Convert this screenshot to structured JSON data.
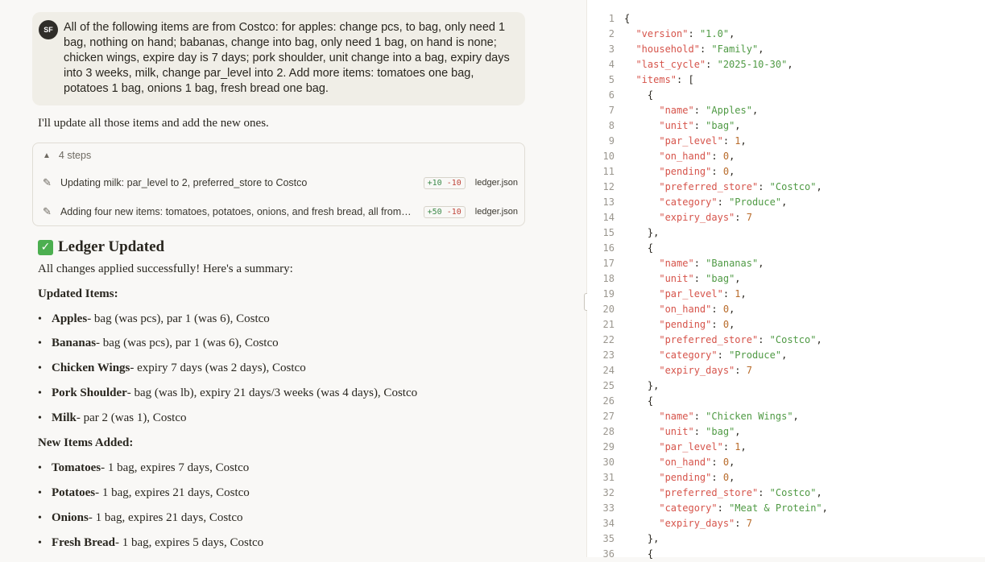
{
  "user_message": {
    "avatar": "SF",
    "lines": [
      "All of the following items are from Costco: for apples: change pcs, to bag, only need 1",
      "bag, nothing on hand; babanas, change into bag, only need 1 bag, on hand is none;",
      "chicken wings, expire day is 7 days; pork shoulder, unit change into a bag, expiry days",
      "into 3 weeks, milk, change par_level into 2. Add more items: tomatoes one bag,",
      "potatoes 1 bag, onions 1 bag, fresh bread one bag."
    ]
  },
  "reply_intro": "I'll update all those items and add the new ones.",
  "steps": {
    "label": "4 steps",
    "items": [
      {
        "text": "Updating milk: par_level to 2, preferred_store to Costco",
        "added": "+10",
        "removed": "-10",
        "file": "ledger.json"
      },
      {
        "text": "Adding four new items: tomatoes, potatoes, onions, and fresh bread, all from…",
        "added": "+50",
        "removed": "-10",
        "file": "ledger.json"
      }
    ]
  },
  "result": {
    "heading": "Ledger Updated",
    "summary": "All changes applied successfully! Here's a summary:",
    "updated_title": "Updated Items:",
    "updated": [
      {
        "name": "Apples",
        "detail": " - bag (was pcs), par 1 (was 6), Costco"
      },
      {
        "name": "Bananas",
        "detail": " - bag (was pcs), par 1 (was 6), Costco"
      },
      {
        "name": "Chicken Wings",
        "detail": " - expiry 7 days (was 2 days), Costco"
      },
      {
        "name": "Pork Shoulder",
        "detail": " - bag (was lb), expiry 21 days/3 weeks (was 4 days), Costco"
      },
      {
        "name": "Milk",
        "detail": " - par 2 (was 1), Costco"
      }
    ],
    "new_title": "New Items Added:",
    "new_items": [
      {
        "name": "Tomatoes",
        "detail": " - 1 bag, expires 7 days, Costco"
      },
      {
        "name": "Potatoes",
        "detail": " - 1 bag, expires 21 days, Costco"
      },
      {
        "name": "Onions",
        "detail": " - 1 bag, expires 21 days, Costco"
      },
      {
        "name": "Fresh Bread",
        "detail": " - 1 bag, expires 5 days, Costco"
      }
    ]
  },
  "code_lines": [
    {
      "n": "1",
      "t": [
        [
          "p",
          "{"
        ]
      ]
    },
    {
      "n": "2",
      "t": [
        [
          "p",
          "  "
        ],
        [
          "k",
          "\"version\""
        ],
        [
          "p",
          ": "
        ],
        [
          "s",
          "\"1.0\""
        ],
        [
          "p",
          ","
        ]
      ]
    },
    {
      "n": "3",
      "t": [
        [
          "p",
          "  "
        ],
        [
          "k",
          "\"household\""
        ],
        [
          "p",
          ": "
        ],
        [
          "s",
          "\"Family\""
        ],
        [
          "p",
          ","
        ]
      ]
    },
    {
      "n": "4",
      "t": [
        [
          "p",
          "  "
        ],
        [
          "k",
          "\"last_cycle\""
        ],
        [
          "p",
          ": "
        ],
        [
          "s",
          "\"2025-10-30\""
        ],
        [
          "p",
          ","
        ]
      ]
    },
    {
      "n": "5",
      "t": [
        [
          "p",
          "  "
        ],
        [
          "k",
          "\"items\""
        ],
        [
          "p",
          ": ["
        ]
      ]
    },
    {
      "n": "6",
      "t": [
        [
          "p",
          "    {"
        ]
      ]
    },
    {
      "n": "7",
      "t": [
        [
          "p",
          "      "
        ],
        [
          "k",
          "\"name\""
        ],
        [
          "p",
          ": "
        ],
        [
          "s",
          "\"Apples\""
        ],
        [
          "p",
          ","
        ]
      ]
    },
    {
      "n": "8",
      "t": [
        [
          "p",
          "      "
        ],
        [
          "k",
          "\"unit\""
        ],
        [
          "p",
          ": "
        ],
        [
          "s",
          "\"bag\""
        ],
        [
          "p",
          ","
        ]
      ]
    },
    {
      "n": "9",
      "t": [
        [
          "p",
          "      "
        ],
        [
          "k",
          "\"par_level\""
        ],
        [
          "p",
          ": "
        ],
        [
          "n",
          "1"
        ],
        [
          "p",
          ","
        ]
      ]
    },
    {
      "n": "10",
      "t": [
        [
          "p",
          "      "
        ],
        [
          "k",
          "\"on_hand\""
        ],
        [
          "p",
          ": "
        ],
        [
          "n",
          "0"
        ],
        [
          "p",
          ","
        ]
      ]
    },
    {
      "n": "11",
      "t": [
        [
          "p",
          "      "
        ],
        [
          "k",
          "\"pending\""
        ],
        [
          "p",
          ": "
        ],
        [
          "n",
          "0"
        ],
        [
          "p",
          ","
        ]
      ]
    },
    {
      "n": "12",
      "t": [
        [
          "p",
          "      "
        ],
        [
          "k",
          "\"preferred_store\""
        ],
        [
          "p",
          ": "
        ],
        [
          "s",
          "\"Costco\""
        ],
        [
          "p",
          ","
        ]
      ]
    },
    {
      "n": "13",
      "t": [
        [
          "p",
          "      "
        ],
        [
          "k",
          "\"category\""
        ],
        [
          "p",
          ": "
        ],
        [
          "s",
          "\"Produce\""
        ],
        [
          "p",
          ","
        ]
      ]
    },
    {
      "n": "14",
      "t": [
        [
          "p",
          "      "
        ],
        [
          "k",
          "\"expiry_days\""
        ],
        [
          "p",
          ": "
        ],
        [
          "n",
          "7"
        ]
      ]
    },
    {
      "n": "15",
      "t": [
        [
          "p",
          "    },"
        ]
      ]
    },
    {
      "n": "16",
      "t": [
        [
          "p",
          "    {"
        ]
      ]
    },
    {
      "n": "17",
      "t": [
        [
          "p",
          "      "
        ],
        [
          "k",
          "\"name\""
        ],
        [
          "p",
          ": "
        ],
        [
          "s",
          "\"Bananas\""
        ],
        [
          "p",
          ","
        ]
      ]
    },
    {
      "n": "18",
      "t": [
        [
          "p",
          "      "
        ],
        [
          "k",
          "\"unit\""
        ],
        [
          "p",
          ": "
        ],
        [
          "s",
          "\"bag\""
        ],
        [
          "p",
          ","
        ]
      ]
    },
    {
      "n": "19",
      "t": [
        [
          "p",
          "      "
        ],
        [
          "k",
          "\"par_level\""
        ],
        [
          "p",
          ": "
        ],
        [
          "n",
          "1"
        ],
        [
          "p",
          ","
        ]
      ]
    },
    {
      "n": "20",
      "t": [
        [
          "p",
          "      "
        ],
        [
          "k",
          "\"on_hand\""
        ],
        [
          "p",
          ": "
        ],
        [
          "n",
          "0"
        ],
        [
          "p",
          ","
        ]
      ]
    },
    {
      "n": "21",
      "t": [
        [
          "p",
          "      "
        ],
        [
          "k",
          "\"pending\""
        ],
        [
          "p",
          ": "
        ],
        [
          "n",
          "0"
        ],
        [
          "p",
          ","
        ]
      ]
    },
    {
      "n": "22",
      "t": [
        [
          "p",
          "      "
        ],
        [
          "k",
          "\"preferred_store\""
        ],
        [
          "p",
          ": "
        ],
        [
          "s",
          "\"Costco\""
        ],
        [
          "p",
          ","
        ]
      ]
    },
    {
      "n": "23",
      "t": [
        [
          "p",
          "      "
        ],
        [
          "k",
          "\"category\""
        ],
        [
          "p",
          ": "
        ],
        [
          "s",
          "\"Produce\""
        ],
        [
          "p",
          ","
        ]
      ]
    },
    {
      "n": "24",
      "t": [
        [
          "p",
          "      "
        ],
        [
          "k",
          "\"expiry_days\""
        ],
        [
          "p",
          ": "
        ],
        [
          "n",
          "7"
        ]
      ]
    },
    {
      "n": "25",
      "t": [
        [
          "p",
          "    },"
        ]
      ]
    },
    {
      "n": "26",
      "t": [
        [
          "p",
          "    {"
        ]
      ]
    },
    {
      "n": "27",
      "t": [
        [
          "p",
          "      "
        ],
        [
          "k",
          "\"name\""
        ],
        [
          "p",
          ": "
        ],
        [
          "s",
          "\"Chicken Wings\""
        ],
        [
          "p",
          ","
        ]
      ]
    },
    {
      "n": "28",
      "t": [
        [
          "p",
          "      "
        ],
        [
          "k",
          "\"unit\""
        ],
        [
          "p",
          ": "
        ],
        [
          "s",
          "\"bag\""
        ],
        [
          "p",
          ","
        ]
      ]
    },
    {
      "n": "29",
      "t": [
        [
          "p",
          "      "
        ],
        [
          "k",
          "\"par_level\""
        ],
        [
          "p",
          ": "
        ],
        [
          "n",
          "1"
        ],
        [
          "p",
          ","
        ]
      ]
    },
    {
      "n": "30",
      "t": [
        [
          "p",
          "      "
        ],
        [
          "k",
          "\"on_hand\""
        ],
        [
          "p",
          ": "
        ],
        [
          "n",
          "0"
        ],
        [
          "p",
          ","
        ]
      ]
    },
    {
      "n": "31",
      "t": [
        [
          "p",
          "      "
        ],
        [
          "k",
          "\"pending\""
        ],
        [
          "p",
          ": "
        ],
        [
          "n",
          "0"
        ],
        [
          "p",
          ","
        ]
      ]
    },
    {
      "n": "32",
      "t": [
        [
          "p",
          "      "
        ],
        [
          "k",
          "\"preferred_store\""
        ],
        [
          "p",
          ": "
        ],
        [
          "s",
          "\"Costco\""
        ],
        [
          "p",
          ","
        ]
      ]
    },
    {
      "n": "33",
      "t": [
        [
          "p",
          "      "
        ],
        [
          "k",
          "\"category\""
        ],
        [
          "p",
          ": "
        ],
        [
          "s",
          "\"Meat & Protein\""
        ],
        [
          "p",
          ","
        ]
      ]
    },
    {
      "n": "34",
      "t": [
        [
          "p",
          "      "
        ],
        [
          "k",
          "\"expiry_days\""
        ],
        [
          "p",
          ": "
        ],
        [
          "n",
          "7"
        ]
      ]
    },
    {
      "n": "35",
      "t": [
        [
          "p",
          "    },"
        ]
      ]
    },
    {
      "n": "36",
      "t": [
        [
          "p",
          "    {"
        ]
      ]
    }
  ]
}
